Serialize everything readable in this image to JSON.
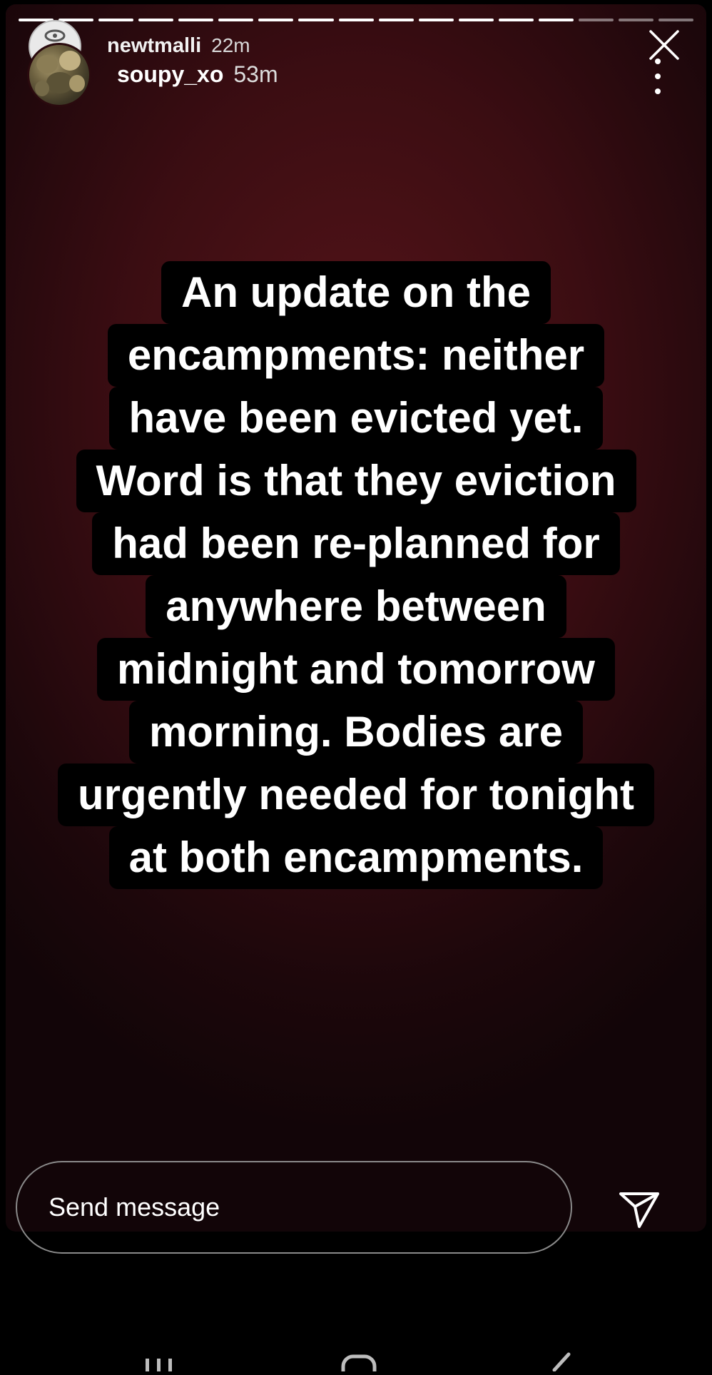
{
  "story": {
    "progress_segments": 17,
    "progress_viewed": 14,
    "accent_background": "#3b0d12",
    "caption_lines": [
      "An update on the",
      "encampments: neither",
      "have been evicted yet.",
      "Word is that they eviction",
      "had been re-planned for",
      "anywhere between",
      "midnight and tomorrow",
      "morning. Bodies are",
      "urgently needed for tonight",
      "at both encampments."
    ]
  },
  "header": {
    "reposter": {
      "username": "newtmalli",
      "time": "22m",
      "avatar_icon": "avatar-icon"
    },
    "author": {
      "username": "soupy_xo",
      "time": "53m",
      "avatar_icon": "avatar-icon"
    },
    "close_icon": "close-icon",
    "more_icon": "more-vertical-icon"
  },
  "footer": {
    "message_placeholder": "Send message",
    "send_icon": "send-icon"
  },
  "system_nav": {
    "recent_icon": "recent-apps-icon",
    "home_icon": "home-icon",
    "back_icon": "back-icon"
  }
}
